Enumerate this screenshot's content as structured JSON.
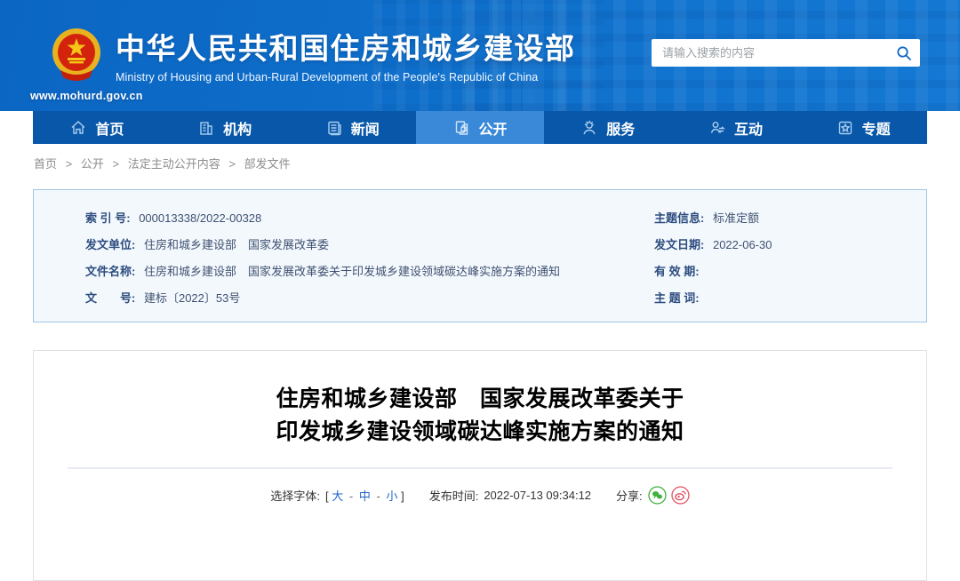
{
  "header": {
    "site_url": "www.mohurd.gov.cn",
    "title_cn": "中华人民共和国住房和城乡建设部",
    "title_en": "Ministry of Housing and Urban-Rural Development of the People's Republic of China",
    "search_placeholder": "请输入搜索的内容",
    "search_value": ""
  },
  "nav": {
    "items": [
      {
        "label": "首页",
        "icon": "home-icon",
        "active": false
      },
      {
        "label": "机构",
        "icon": "organization-icon",
        "active": false
      },
      {
        "label": "新闻",
        "icon": "news-icon",
        "active": false
      },
      {
        "label": "公开",
        "icon": "disclosure-icon",
        "active": true
      },
      {
        "label": "服务",
        "icon": "service-icon",
        "active": false
      },
      {
        "label": "互动",
        "icon": "interaction-icon",
        "active": false
      },
      {
        "label": "专题",
        "icon": "special-topic-icon",
        "active": false
      }
    ]
  },
  "breadcrumb": {
    "separator": ">",
    "items": [
      "首页",
      "公开",
      "法定主动公开内容",
      "部发文件"
    ]
  },
  "doc_info": {
    "left": [
      {
        "label": "索 引 号:",
        "value": "000013338/2022-00328"
      },
      {
        "label": "发文单位:",
        "value": "住房和城乡建设部　国家发展改革委"
      },
      {
        "label": "文件名称:",
        "value": "住房和城乡建设部　国家发展改革委关于印发城乡建设领域碳达峰实施方案的通知"
      },
      {
        "label": "文　　号:",
        "value": "建标〔2022〕53号"
      }
    ],
    "right": [
      {
        "label": "主题信息:",
        "value": "标准定额"
      },
      {
        "label": "发文日期:",
        "value": "2022-06-30"
      },
      {
        "label": "有 效 期:",
        "value": ""
      },
      {
        "label": "主 题 词:",
        "value": ""
      }
    ]
  },
  "article": {
    "title_line1": "住房和城乡建设部　国家发展改革委关于",
    "title_line2": "印发城乡建设领域碳达峰实施方案的通知",
    "font_select_label": "选择字体:",
    "bracket_open": "[",
    "bracket_close": "]",
    "font_separator": "-",
    "font_size_large": "大",
    "font_size_medium": "中",
    "font_size_small": "小",
    "publish_label": "发布时间:",
    "publish_time": "2022-07-13 09:34:12",
    "share_label": "分享:"
  },
  "colors": {
    "header_blue": "#0e6fca",
    "nav_blue": "#0857a8",
    "nav_active_blue": "#3a89d8",
    "infobox_bg": "#f3f8fd",
    "infobox_border": "#9ec5e8",
    "label_navy": "#2c4c7e",
    "link_blue": "#1b66c9",
    "wechat_green": "#42b03d",
    "weibo_red": "#e25565"
  }
}
